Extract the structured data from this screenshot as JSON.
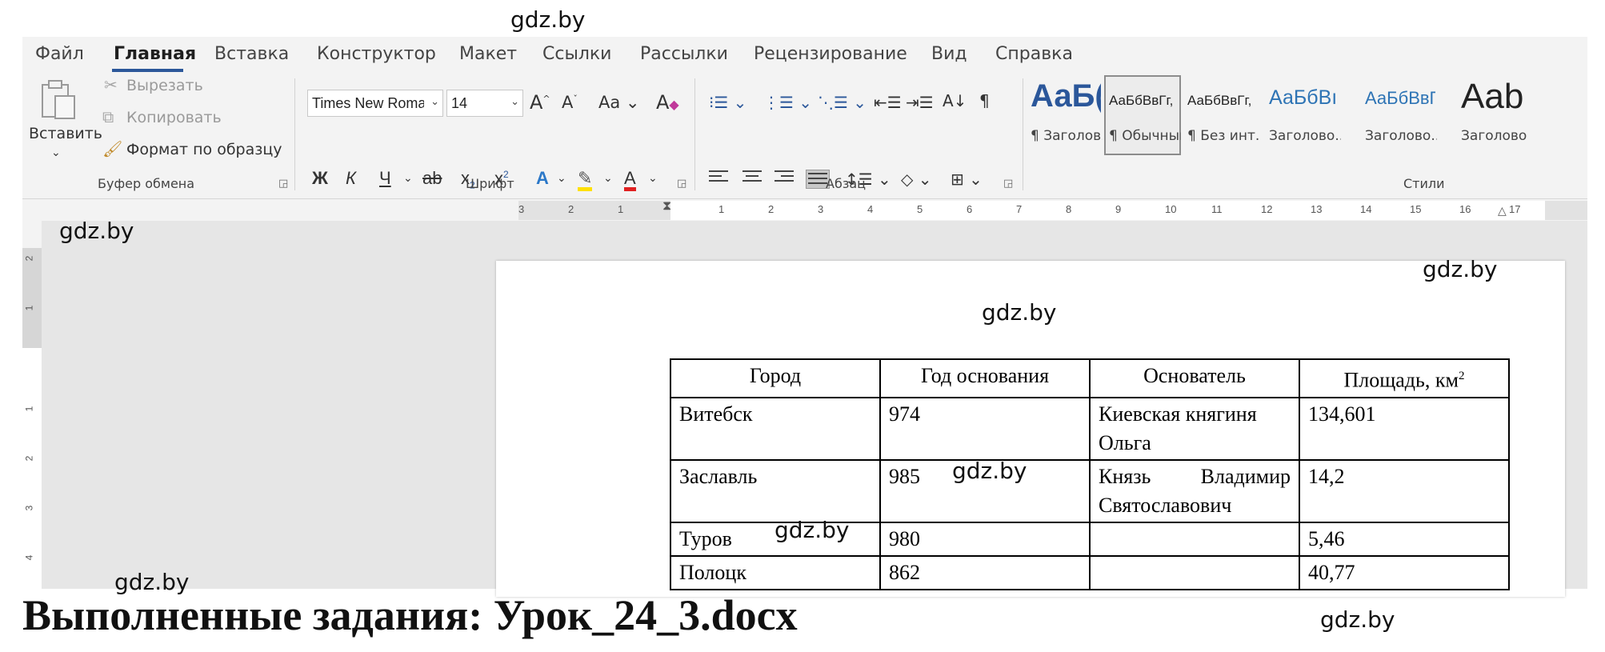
{
  "watermark": "gdz.by",
  "menu": {
    "tabs": [
      "Файл",
      "Главная",
      "Вставка",
      "Конструктор",
      "Макет",
      "Ссылки",
      "Рассылки",
      "Рецензирование",
      "Вид",
      "Справка"
    ],
    "active": "Главная"
  },
  "ribbon": {
    "clipboard": {
      "paste_label": "Вставить",
      "cut_label": "Вырезать",
      "copy_label": "Копировать",
      "format_painter_label": "Формат по образцу",
      "group_label": "Буфер обмена"
    },
    "font": {
      "font_name": "Times New Roman",
      "font_size": "14",
      "bold": "Ж",
      "italic": "К",
      "underline": "Ч",
      "strike": "ab",
      "group_label": "Шрифт"
    },
    "paragraph": {
      "group_label": "Абзац"
    },
    "styles": {
      "group_label": "Стили",
      "items": [
        {
          "sample": "АаБ(",
          "name": "¶ Заголов..."
        },
        {
          "sample": "АаБбВвГг,",
          "name": "¶ Обычный"
        },
        {
          "sample": "АаБбВвГг,",
          "name": "¶ Без инт..."
        },
        {
          "sample": "АаБбВı",
          "name": "Заголово..."
        },
        {
          "sample": "АаБбВвГ",
          "name": "Заголово..."
        },
        {
          "sample": "Aab",
          "name": "Заголово"
        }
      ]
    }
  },
  "ruler": {
    "numbers": [
      "3",
      "2",
      "1",
      "1",
      "2",
      "3",
      "4",
      "5",
      "6",
      "7",
      "8",
      "9",
      "10",
      "11",
      "12",
      "13",
      "14",
      "15",
      "16",
      "17"
    ],
    "vertical_numbers": [
      "2",
      "1",
      "1",
      "2",
      "3",
      "4"
    ]
  },
  "table": {
    "headers": [
      "Город",
      "Год основания",
      "Основатель",
      "Площадь, км"
    ],
    "area_superscript": "2",
    "rows": [
      [
        "Витебск",
        "974",
        "Киевская княгиня Ольга",
        "134,601"
      ],
      [
        "Заславль",
        "985",
        "Князь Владимир Святославович",
        "14,2"
      ],
      [
        "Туров",
        "980",
        "",
        "5,46"
      ],
      [
        "Полоцк",
        "862",
        "",
        "40,77"
      ]
    ]
  },
  "footer_title": "Выполненные задания: Урок_24_3.docx",
  "colors": {
    "accent": "#2b579a",
    "style_heading": "#2b579a"
  }
}
